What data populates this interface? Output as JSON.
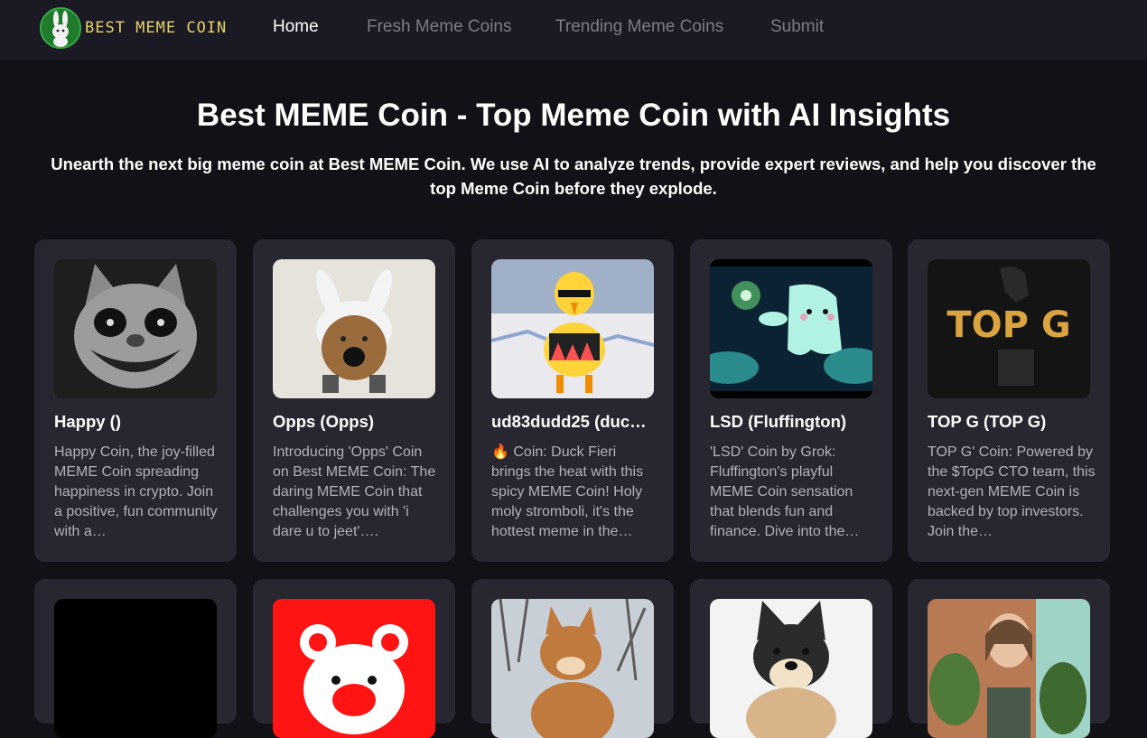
{
  "nav": {
    "logo_text": "BEST MEME COIN",
    "links": [
      {
        "label": "Home",
        "active": true
      },
      {
        "label": "Fresh Meme Coins",
        "active": false
      },
      {
        "label": "Trending Meme Coins",
        "active": false
      },
      {
        "label": "Submit",
        "active": false
      }
    ]
  },
  "hero": {
    "title": "Best MEME Coin - Top Meme Coin with AI Insights",
    "subtitle": "Unearth the next big meme coin at Best MEME Coin. We use AI to analyze trends, provide expert reviews, and help you discover the top Meme Coin before they explode."
  },
  "cards": [
    {
      "title": "Happy ()",
      "description": "Happy Coin, the joy-filled MEME Coin spreading happiness in crypto. Join a positive, fun community with a…"
    },
    {
      "title": "Opps (Opps)",
      "description": "Introducing 'Opps' Coin on Best MEME Coin: The daring MEME Coin that challenges you with 'i dare u to jeet'…."
    },
    {
      "title": "ud83dudd25 (duc…",
      "description": "🔥 Coin: Duck Fieri brings the heat with this spicy MEME Coin! Holy moly stromboli, it's the hottest meme in the…"
    },
    {
      "title": "LSD (Fluffington)",
      "description": "'LSD' Coin by Grok: Fluffington's playful MEME Coin sensation that blends fun and finance. Dive into the…"
    },
    {
      "title": "TOP G (TOP G)",
      "description": "TOP G' Coin: Powered by the $TopG CTO team, this next-gen MEME Coin is backed by top investors. Join the…"
    }
  ],
  "logo_thumbnail_text": "TOP G",
  "colors": {
    "background": "#121117",
    "nav_background": "#1b1a24",
    "card_background": "#272631",
    "logo_text": "#e8d36a",
    "nav_inactive": "#7c7b86"
  }
}
